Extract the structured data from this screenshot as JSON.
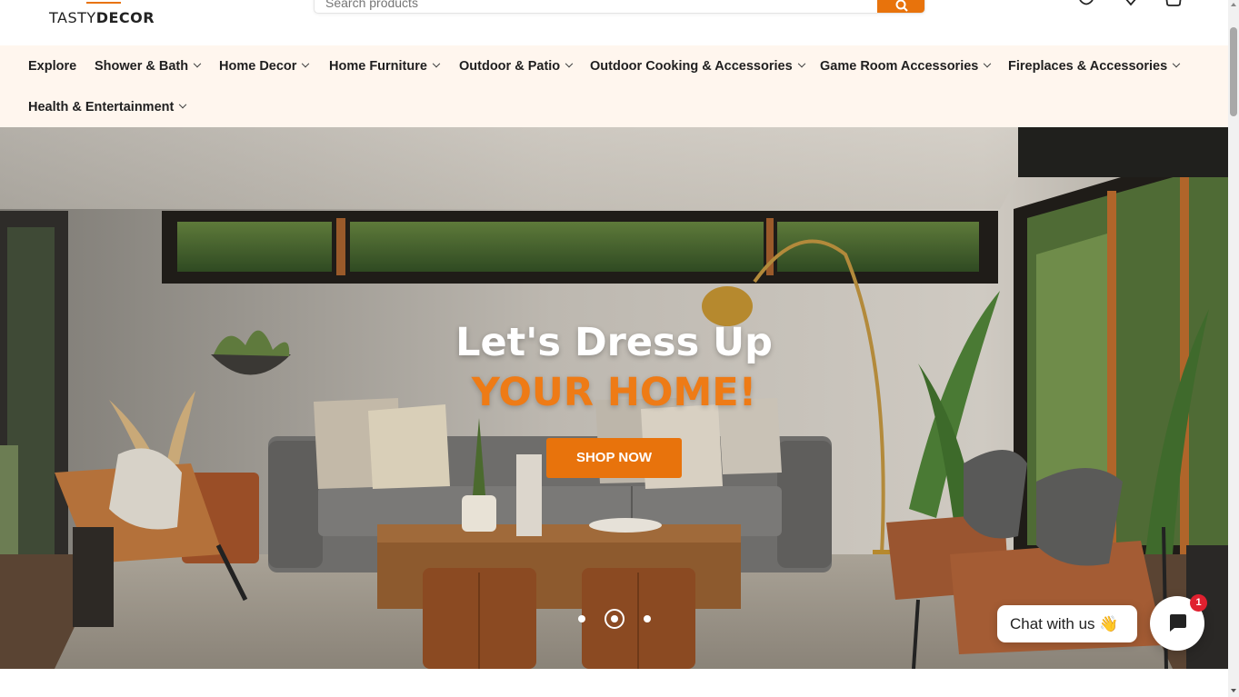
{
  "brand": {
    "name_light": "TASTY",
    "name_bold": "DECOR",
    "accent": "#e8730c"
  },
  "search": {
    "placeholder": "Search products",
    "button_icon": "search-icon"
  },
  "header_icons": [
    "user-icon",
    "heart-icon",
    "cart-icon"
  ],
  "nav": {
    "items": [
      {
        "label": "Explore",
        "has_dropdown": false
      },
      {
        "label": "Shower & Bath",
        "has_dropdown": true
      },
      {
        "label": "Home Decor",
        "has_dropdown": true
      },
      {
        "label": "Home Furniture",
        "has_dropdown": true
      },
      {
        "label": "Outdoor & Patio",
        "has_dropdown": true
      },
      {
        "label": "Outdoor Cooking & Accessories",
        "has_dropdown": true
      },
      {
        "label": "Game Room Accessories",
        "has_dropdown": true
      },
      {
        "label": "Fireplaces & Accessories",
        "has_dropdown": true
      },
      {
        "label": "Health & Entertainment",
        "has_dropdown": true
      }
    ],
    "background": "#fff6ee"
  },
  "hero": {
    "title": "Let's Dress Up",
    "subtitle": "YOUR HOME!",
    "cta_label": "SHOP NOW",
    "slides": {
      "count": 3,
      "active": 2
    }
  },
  "chat": {
    "label": "Chat with us 👋",
    "badge_count": "1",
    "icon": "chat-icon"
  }
}
